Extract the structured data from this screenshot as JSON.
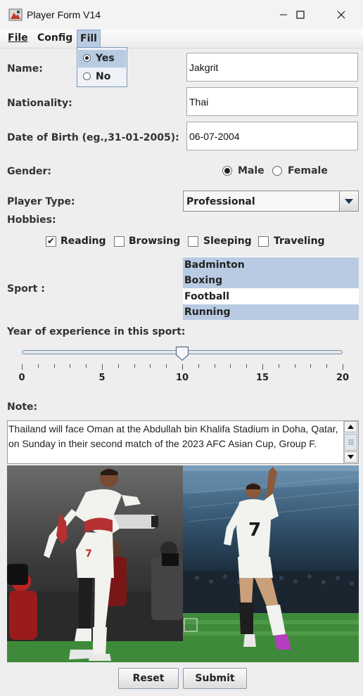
{
  "window": {
    "title": "Player Form V14"
  },
  "menu": {
    "file": "File",
    "config": "Config",
    "fill": "Fill"
  },
  "fill_menu": {
    "options": [
      "Yes",
      "No"
    ],
    "selected": "Yes"
  },
  "form": {
    "name_label": "Name:",
    "name_value": "Jakgrit",
    "nationality_label": "Nationality:",
    "nationality_value": "Thai",
    "dob_label": "Date of Birth (eg.,31-01-2005):",
    "dob_value": "06-07-2004",
    "gender_label": "Gender:",
    "gender_options": [
      "Male",
      "Female"
    ],
    "gender_selected": "Male",
    "player_type_label": "Player Type:",
    "player_type_value": "Professional",
    "hobbies_label": "Hobbies:",
    "hobbies": [
      {
        "label": "Reading",
        "checked": true
      },
      {
        "label": "Browsing",
        "checked": false
      },
      {
        "label": "Sleeping",
        "checked": false
      },
      {
        "label": "Traveling",
        "checked": false
      }
    ],
    "sport_label": "Sport :",
    "sports": [
      {
        "label": "Badminton",
        "selected": true
      },
      {
        "label": "Boxing",
        "selected": true
      },
      {
        "label": "Football",
        "selected": false
      },
      {
        "label": "Running",
        "selected": true
      }
    ],
    "experience_label": "Year of experience in this sport:",
    "experience": {
      "min": 0,
      "max": 20,
      "value": 10,
      "major_labels": [
        "0",
        "5",
        "10",
        "15",
        "20"
      ]
    },
    "note_label": "Note:",
    "note_text": "Thailand will face Oman at the Abdullah bin Khalifa Stadium in Doha, Qatar, on Sunday in their second match of the 2023 AFC Asian Cup, Group F.",
    "photo_left_number": "7",
    "photo_right_number": "7",
    "reset_label": "Reset",
    "submit_label": "Submit"
  },
  "colors": {
    "selection": "#b8cbe3",
    "window_bg": "#eeeeee",
    "pitch": "#3f8a3a"
  },
  "icons": [
    "app-icon",
    "minimize-icon",
    "maximize-icon",
    "close-icon",
    "dropdown-arrow-icon",
    "scroll-up-icon",
    "scroll-down-icon",
    "slider-thumb-icon"
  ]
}
